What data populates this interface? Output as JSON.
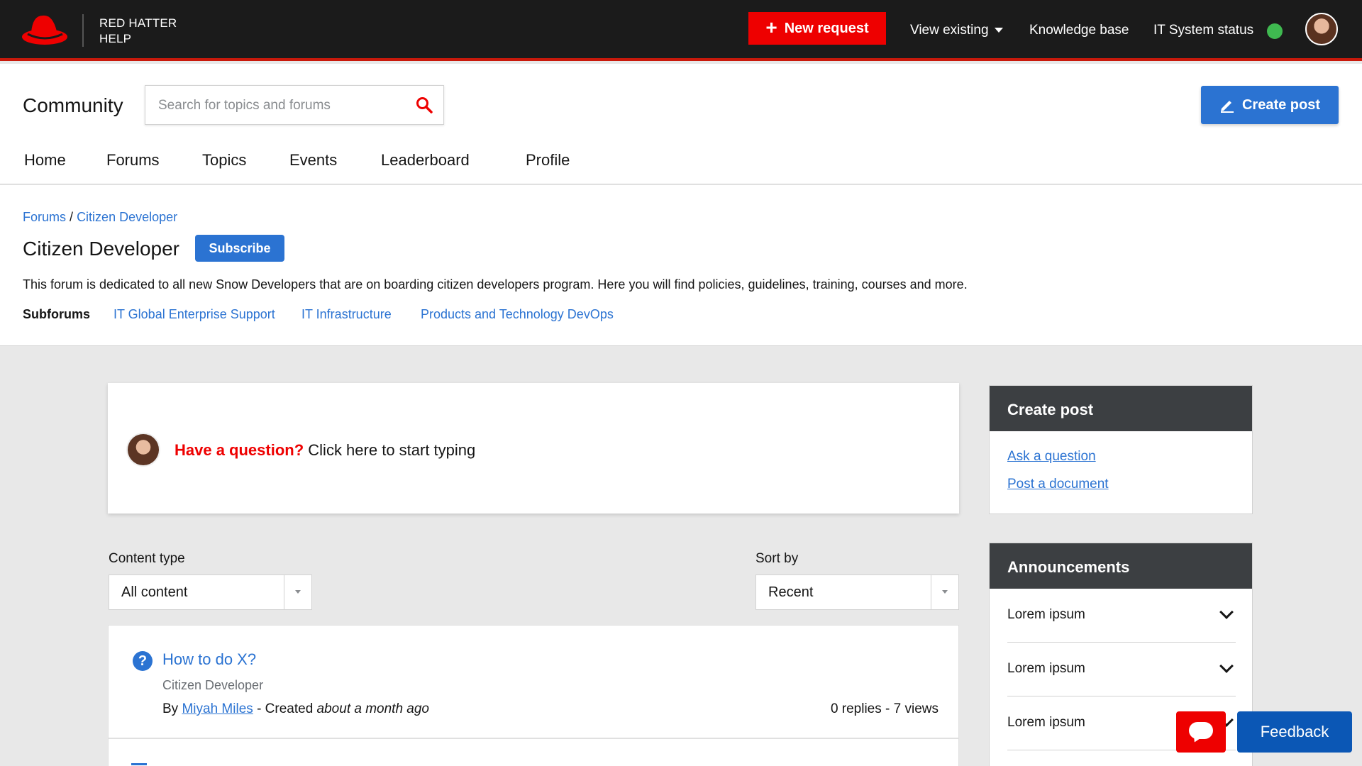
{
  "brand": {
    "line1": "RED HATTER",
    "line2": "HELP"
  },
  "topbar": {
    "new_request": "New request",
    "view_existing": "View existing",
    "knowledge_base": "Knowledge base",
    "it_status": "IT System status",
    "status_color": "#3fb950",
    "accent": "#ee0000"
  },
  "community": {
    "title": "Community",
    "search_placeholder": "Search for topics and forums",
    "create_post": "Create post"
  },
  "nav": [
    "Home",
    "Forums",
    "Topics",
    "Events",
    "Leaderboard",
    "Profile"
  ],
  "breadcrumb": {
    "root": "Forums",
    "sep": "/",
    "current": "Citizen Developer"
  },
  "forum": {
    "title": "Citizen Developer",
    "subscribe": "Subscribe",
    "description": "This forum is dedicated to all new Snow Developers that are on boarding citizen developers program. Here you will find policies, guidelines, training, courses and more.",
    "subforums_label": "Subforums",
    "subforums": [
      "IT Global Enterprise Support",
      "IT Infrastructure",
      "Products and Technology DevOps"
    ]
  },
  "question": {
    "accent": "Have a question?",
    "prompt": "Click here to start typing"
  },
  "filters": {
    "content_type_label": "Content type",
    "content_type_value": "All content",
    "sort_label": "Sort by",
    "sort_value": "Recent"
  },
  "posts": [
    {
      "icon": "question-circle-icon",
      "title": "How to do X?",
      "forum": "Citizen Developer",
      "by": "By",
      "author": "Miyah Miles",
      "created": "- Created",
      "ago": "about a month ago",
      "stats": "0 replies - 7 views"
    }
  ],
  "sidebar": {
    "create_post_title": "Create post",
    "links": [
      "Ask a question",
      "Post a document"
    ],
    "announcements_title": "Announcements",
    "announcements": [
      "Lorem ipsum",
      "Lorem ipsum",
      "Lorem ipsum"
    ]
  },
  "floating": {
    "feedback": "Feedback"
  }
}
